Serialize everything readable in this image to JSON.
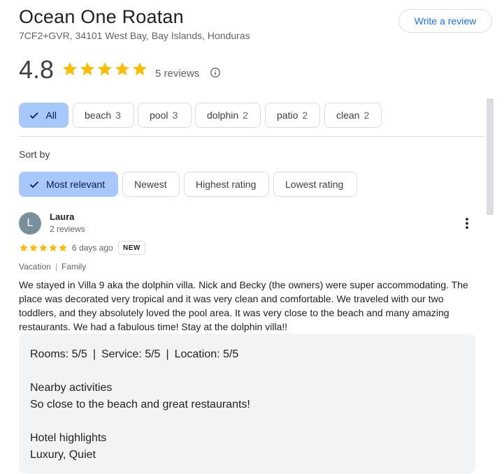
{
  "place": {
    "name": "Ocean One Roatan",
    "address": "7CF2+GVR, 34101 West Bay, Bay Islands, Honduras",
    "rating": "4.8",
    "star_count": 5,
    "review_count_label": "5 reviews",
    "star_color": "#fbbc04"
  },
  "actions": {
    "write_review_label": "Write a review"
  },
  "topic_filters": [
    {
      "label": "All",
      "count": "",
      "selected": true
    },
    {
      "label": "beach",
      "count": "3",
      "selected": false
    },
    {
      "label": "pool",
      "count": "3",
      "selected": false
    },
    {
      "label": "dolphin",
      "count": "2",
      "selected": false
    },
    {
      "label": "patio",
      "count": "2",
      "selected": false
    },
    {
      "label": "clean",
      "count": "2",
      "selected": false
    }
  ],
  "sort": {
    "label": "Sort by",
    "options": [
      {
        "label": "Most relevant",
        "selected": true
      },
      {
        "label": "Newest",
        "selected": false
      },
      {
        "label": "Highest rating",
        "selected": false
      },
      {
        "label": "Lowest rating",
        "selected": false
      }
    ]
  },
  "review": {
    "avatar_letter": "L",
    "author": "Laura",
    "author_reviews": "2 reviews",
    "stars": 5,
    "date": "6 days ago",
    "badge": "NEW",
    "trip_type": "Vacation",
    "travel_group": "Family",
    "text": "We stayed in Villa 9 aka the dolphin villa. Nick and Becky (the owners) were super accommodating. The place was decorated very tropical and it was very clean and comfortable. We traveled with our two toddlers, and they absolutely loved the pool area. It was very close to the beach and many amazing restaurants. We had a fabulous time! Stay at the dolphin villa!!",
    "ratings": {
      "rooms": "Rooms: 5/5",
      "service": "Service: 5/5",
      "location": "Location: 5/5",
      "separator": "|"
    },
    "nearby_heading": "Nearby activities",
    "nearby_text": "So close to the beach and great restaurants!",
    "highlights_heading": "Hotel highlights",
    "highlights_text": "Luxury, Quiet"
  },
  "colors": {
    "selected_chip_bg": "#a8c7fa",
    "link_blue": "#1a73e8",
    "avatar_bg": "#78909c",
    "details_bg": "#f1f3f4"
  }
}
